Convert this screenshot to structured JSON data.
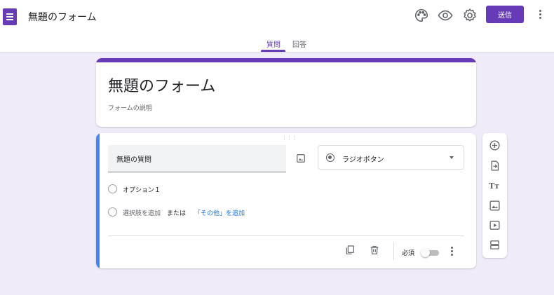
{
  "header": {
    "app_icon": "google-forms-icon",
    "doc_title": "無題のフォーム",
    "icons": [
      "palette-icon",
      "eye-icon",
      "gear-icon"
    ],
    "send_label": "送信",
    "more_icon": "more-vert-icon"
  },
  "tabs": [
    {
      "label": "質問",
      "active": true
    },
    {
      "label": "回答",
      "active": false
    }
  ],
  "form": {
    "title": "無題のフォーム",
    "description_placeholder": "フォームの説明"
  },
  "question": {
    "title": "無題の質問",
    "type_label": "ラジオボタン",
    "options": [
      "オプション１"
    ],
    "add_option": "選択肢を追加",
    "or_text": "または",
    "add_other": "「その他」を追加",
    "required_label": "必須",
    "required": false
  },
  "side_toolbar": {
    "icons": [
      "add-circle-icon",
      "import-icon",
      "title-text-icon",
      "image-icon",
      "video-icon",
      "section-icon"
    ],
    "title_glyph": "Tт"
  },
  "colors": {
    "accent": "#673ab7",
    "background": "#f0ebf8",
    "active_bar": "#4285f4",
    "link": "#1a73e8"
  }
}
